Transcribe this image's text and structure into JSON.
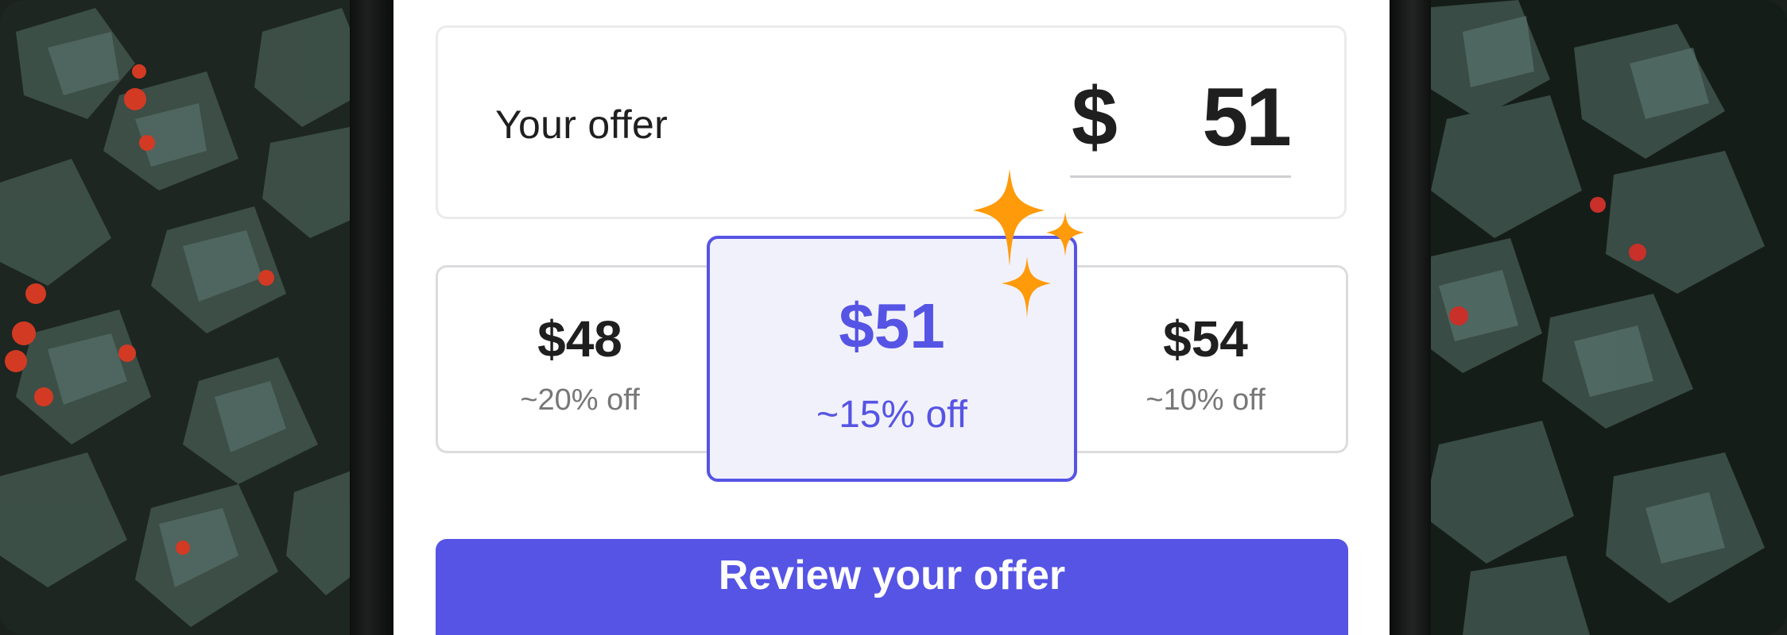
{
  "offer": {
    "label": "Your offer",
    "currency": "$",
    "amount": "51"
  },
  "options": [
    {
      "price": "$48",
      "discount": "~20% off",
      "selected": false
    },
    {
      "price": "$51",
      "discount": "~15% off",
      "selected": true
    },
    {
      "price": "$54",
      "discount": "~10% off",
      "selected": false
    }
  ],
  "cta": {
    "label": "Review your offer"
  },
  "icons": {
    "sparkle": "sparkles-icon",
    "background": "holly-leaves-background"
  },
  "colors": {
    "accent": "#5654e4",
    "accent_bg": "#f1f1fb",
    "sparkle": "#ff9a0a",
    "text": "#1f1f1f",
    "muted": "#777777"
  }
}
